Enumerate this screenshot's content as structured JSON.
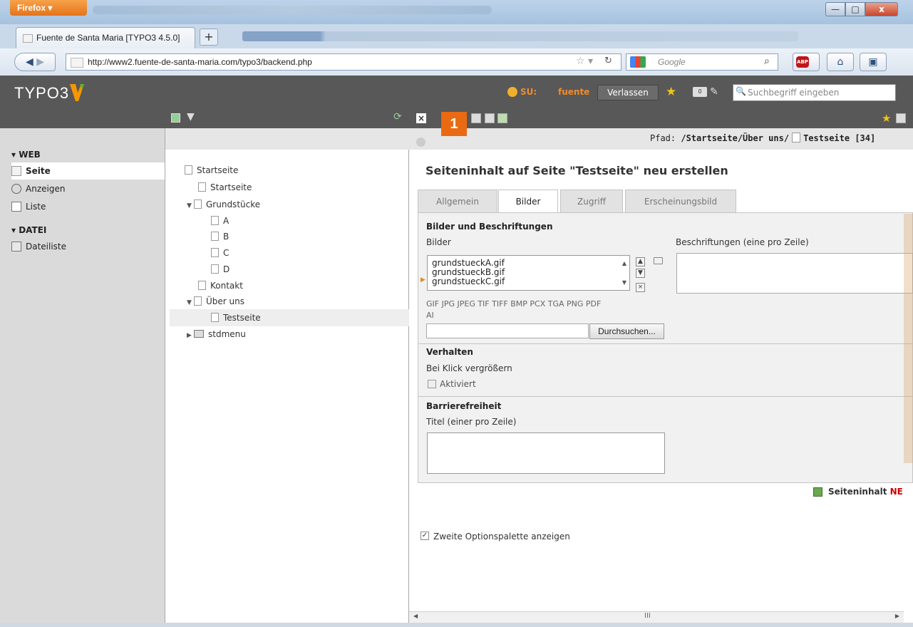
{
  "browser": {
    "menu_label": "Firefox",
    "window_buttons": {
      "minimize": "—",
      "maximize": "□",
      "close": "x"
    },
    "tab_title": "Fuente de Santa Maria [TYPO3 4.5.0]",
    "new_tab_label": "+",
    "url": "http://www2.fuente-de-santa-maria.com/typo3/backend.php",
    "search_engine_placeholder": "Google"
  },
  "typo3_header": {
    "logo_text": "TYPO3",
    "user_prefix": "SU:",
    "user_name": "fuente",
    "logout_label": "Verlassen",
    "search_placeholder": "Suchbegriff eingeben",
    "notification_count": "0"
  },
  "modules": {
    "sections": [
      {
        "label": "▾ WEB",
        "items": [
          "Seite",
          "Anzeigen",
          "Liste"
        ]
      },
      {
        "label": "▾ DATEI",
        "items": [
          "Dateiliste"
        ]
      }
    ]
  },
  "page_tree": {
    "nodes": [
      {
        "label": "Startseite"
      },
      {
        "label": "Startseite"
      },
      {
        "label": "Grundstücke"
      },
      {
        "label": "A"
      },
      {
        "label": "B"
      },
      {
        "label": "C"
      },
      {
        "label": "D"
      },
      {
        "label": "Kontakt"
      },
      {
        "label": "Über uns"
      },
      {
        "label": "Testseite"
      },
      {
        "label": "stdmenu"
      }
    ]
  },
  "content": {
    "marker_number": "1",
    "path_label": "Pfad:",
    "path_value": "/Startseite/Über uns/",
    "path_page": "Testseite [34]",
    "title": "Seiteninhalt auf Seite \"Testseite\" neu erstellen",
    "tabs": [
      "Allgemein",
      "Bilder",
      "Zugriff",
      "Erscheinungsbild"
    ],
    "active_tab": "Bilder",
    "section_images": "Bilder und Beschriftungen",
    "images_label": "Bilder",
    "images": [
      "grundstueckA.gif",
      "grundstueckB.gif",
      "grundstueckC.gif"
    ],
    "captions_label": "Beschriftungen (eine pro Zeile)",
    "allowed_types_line1": "GIF JPG JPEG TIF TIFF BMP PCX TGA PNG PDF",
    "allowed_types_line2": "AI",
    "browse_label": "Durchsuchen...",
    "section_behaviour": "Verhalten",
    "click_enlarge_label": "Bei Klick vergrößern",
    "activated_label": "Aktiviert",
    "activated_checked": false,
    "section_accessibility": "Barrierefreiheit",
    "titles_label": "Titel (einer pro Zeile)",
    "ce_new_label": "Seiteninhalt NE",
    "second_options_label": "Zweite Optionspalette anzeigen",
    "second_options_checked": true,
    "scroll_mark": "III"
  },
  "colors": {
    "typo3_dark": "#585858",
    "typo3_orange": "#ea6a13",
    "firefox_orange": "#e3741b"
  }
}
